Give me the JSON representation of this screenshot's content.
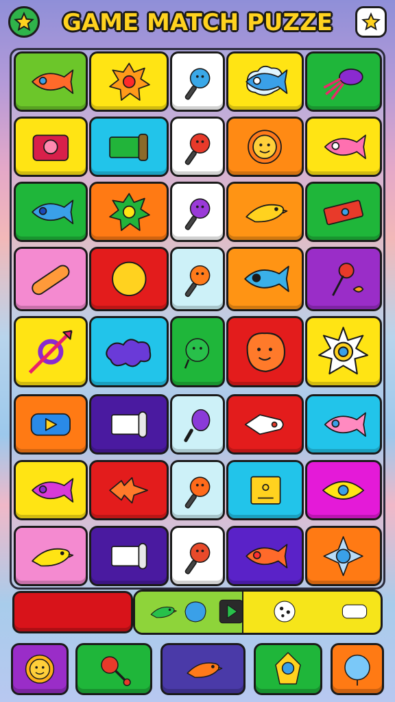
{
  "header": {
    "title": "GAME MATCH PUZZE",
    "left_button_icon": "star-icon",
    "right_button_icon": "star-icon"
  },
  "board": {
    "rows": 8,
    "cols": 5,
    "tiles": [
      [
        {
          "icon": "orange-fish",
          "bg": "#6cc62a"
        },
        {
          "icon": "orange-star-splat",
          "bg": "#ffe414"
        },
        {
          "icon": "blue-rattle",
          "bg": "#ffffff"
        },
        {
          "icon": "blue-fish-cloud",
          "bg": "#ffe414"
        },
        {
          "icon": "purple-squid",
          "bg": "#1fb63a"
        }
      ],
      [
        {
          "icon": "red-camera-box",
          "bg": "#ffe414"
        },
        {
          "icon": "green-package",
          "bg": "#22c4ea"
        },
        {
          "icon": "red-rattle",
          "bg": "#ffffff"
        },
        {
          "icon": "sun-face",
          "bg": "#ff8a14"
        },
        {
          "icon": "pink-fish-eye",
          "bg": "#ffe414"
        }
      ],
      [
        {
          "icon": "blue-fish",
          "bg": "#1fb63a"
        },
        {
          "icon": "green-splat",
          "bg": "#ff7a14"
        },
        {
          "icon": "purple-rattle",
          "bg": "#ffffff"
        },
        {
          "icon": "red-yellow-bird",
          "bg": "#ff9414"
        },
        {
          "icon": "red-plank",
          "bg": "#1fb63a"
        }
      ],
      [
        {
          "icon": "orange-bread",
          "bg": "#f48ad0"
        },
        {
          "icon": "yellow-sun-blob",
          "bg": "#e31c1c"
        },
        {
          "icon": "orange-rattle",
          "bg": "#cdf1f8"
        },
        {
          "icon": "cyan-fish",
          "bg": "#ff9414"
        },
        {
          "icon": "red-dart",
          "bg": "#9a2dc8"
        }
      ],
      [
        {
          "icon": "arrow-ring",
          "bg": "#ffe414"
        },
        {
          "icon": "purple-puzzle-blob",
          "bg": "#22c4ea"
        },
        {
          "icon": "green-germ",
          "bg": "#1fb63a"
        },
        {
          "icon": "orange-blob-face",
          "bg": "#e31c1c"
        },
        {
          "icon": "spiky-ring",
          "bg": "#ffe414"
        }
      ],
      [
        {
          "icon": "blue-play-capsule",
          "bg": "#ff7a14"
        },
        {
          "icon": "white-scroll",
          "bg": "#4a1aa0"
        },
        {
          "icon": "purple-lollipop",
          "bg": "#cdf1f8"
        },
        {
          "icon": "white-rocket",
          "bg": "#e31c1c"
        },
        {
          "icon": "pink-fish",
          "bg": "#22c4ea"
        }
      ],
      [
        {
          "icon": "purple-fish",
          "bg": "#ffe414"
        },
        {
          "icon": "orange-flame-fish",
          "bg": "#e31c1c"
        },
        {
          "icon": "orange-spiky-rattle",
          "bg": "#cdf1f8"
        },
        {
          "icon": "yellow-box",
          "bg": "#22c4ea"
        },
        {
          "icon": "yellow-eye",
          "bg": "#e41ad8"
        }
      ],
      [
        {
          "icon": "yellow-bird",
          "bg": "#f48ad0"
        },
        {
          "icon": "white-scroll-2",
          "bg": "#4a1aa0"
        },
        {
          "icon": "red-face-rattle",
          "bg": "#ffffff"
        },
        {
          "icon": "orange-fish-2",
          "bg": "#5a22c8"
        },
        {
          "icon": "blue-ship",
          "bg": "#ff7a14"
        }
      ]
    ]
  },
  "tray": {
    "slots": [
      "green-bird",
      "blue-rock",
      "play-box",
      "white-ball",
      "white-roll"
    ]
  },
  "bottom_bar": {
    "buttons": [
      {
        "icon": "sun-face-small",
        "bg": "#9a2dc8"
      },
      {
        "icon": "red-rattle-big",
        "bg": "#1fb63a"
      },
      {
        "icon": "orange-bird-small",
        "bg": "#4a3aa8"
      },
      {
        "icon": "rocket-face",
        "bg": "#1fb63a"
      },
      {
        "icon": "blue-balloon",
        "bg": "#ff7a14"
      }
    ]
  }
}
